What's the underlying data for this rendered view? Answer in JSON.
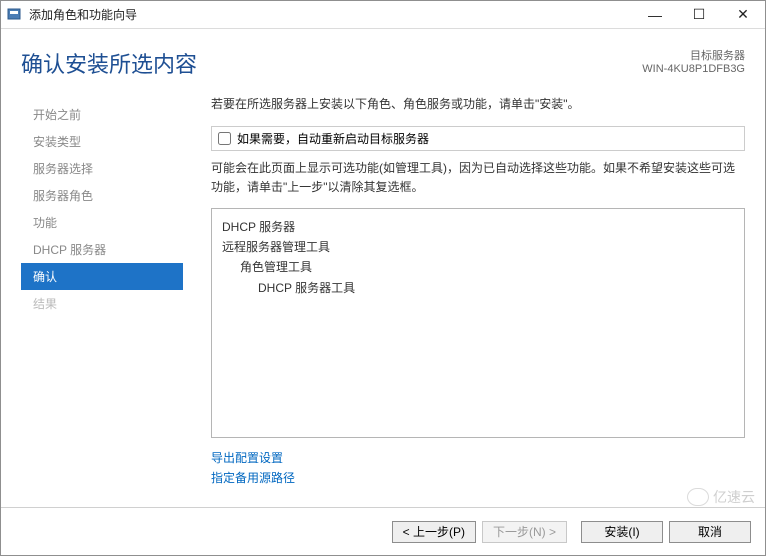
{
  "window": {
    "title": "添加角色和功能向导",
    "min_label": "—",
    "max_label": "☐",
    "close_label": "✕"
  },
  "header": {
    "page_title": "确认安装所选内容",
    "target_label": "目标服务器",
    "target_value": "WIN-4KU8P1DFB3G"
  },
  "nav": {
    "items": [
      {
        "label": "开始之前",
        "state": "done"
      },
      {
        "label": "安装类型",
        "state": "done"
      },
      {
        "label": "服务器选择",
        "state": "done"
      },
      {
        "label": "服务器角色",
        "state": "done"
      },
      {
        "label": "功能",
        "state": "done"
      },
      {
        "label": "DHCP 服务器",
        "state": "done"
      },
      {
        "label": "确认",
        "state": "active"
      },
      {
        "label": "结果",
        "state": "upcoming"
      }
    ]
  },
  "main": {
    "instruction": "若要在所选服务器上安装以下角色、角色服务或功能，请单击\"安装\"。",
    "auto_restart_label": "如果需要，自动重新启动目标服务器",
    "auto_restart_checked": false,
    "note": "可能会在此页面上显示可选功能(如管理工具)，因为已自动选择这些功能。如果不希望安装这些可选功能，请单击\"上一步\"以清除其复选框。",
    "selections": [
      {
        "label": "DHCP 服务器",
        "indent": 0
      },
      {
        "label": "远程服务器管理工具",
        "indent": 0
      },
      {
        "label": "角色管理工具",
        "indent": 1
      },
      {
        "label": "DHCP 服务器工具",
        "indent": 2
      }
    ],
    "link_export": "导出配置设置",
    "link_altsource": "指定备用源路径"
  },
  "footer": {
    "prev": "< 上一步(P)",
    "next": "下一步(N) >",
    "install": "安装(I)",
    "cancel": "取消"
  },
  "watermark": "亿速云"
}
